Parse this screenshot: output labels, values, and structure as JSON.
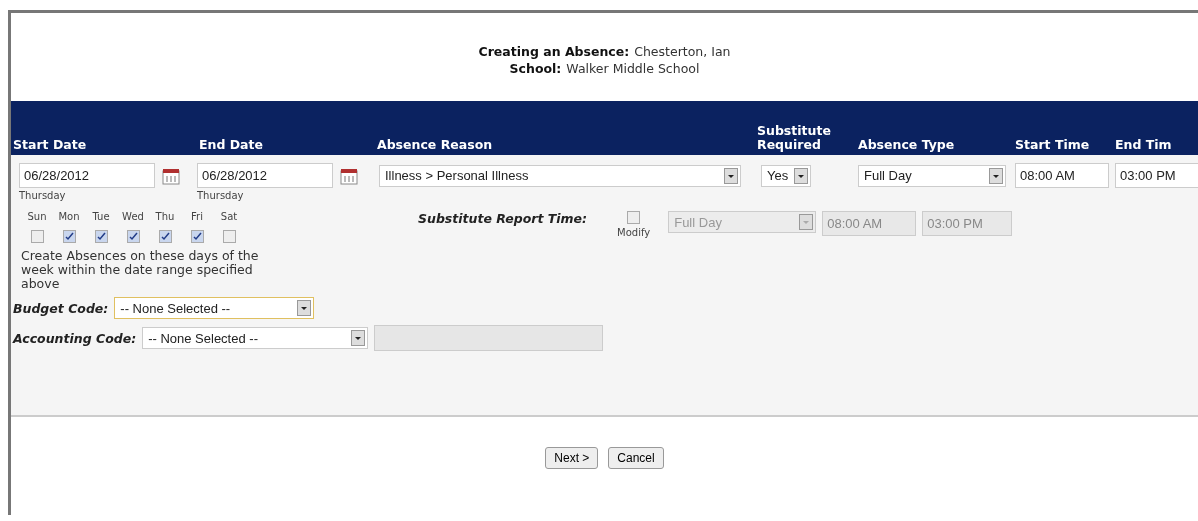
{
  "header": {
    "title_label": "Creating an Absence:",
    "title_value": "Chesterton, Ian",
    "school_label": "School:",
    "school_value": "Walker Middle School"
  },
  "columns": [
    {
      "label": "Start Date"
    },
    {
      "label": "End Date"
    },
    {
      "label": "Absence Reason"
    },
    {
      "label": "Substitute Required"
    },
    {
      "label": "Absence Type"
    },
    {
      "label": "Start Time"
    },
    {
      "label": "End Tim"
    }
  ],
  "start_date": {
    "value": "06/28/2012",
    "weekday": "Thursday"
  },
  "end_date": {
    "value": "06/28/2012",
    "weekday": "Thursday"
  },
  "absence_reason": {
    "value": "Illness > Personal Illness"
  },
  "substitute_required": {
    "value": "Yes"
  },
  "absence_type": {
    "value": "Full Day"
  },
  "start_time": {
    "value": "08:00 AM"
  },
  "end_time": {
    "value": "03:00 PM"
  },
  "days": [
    {
      "label": "Sun",
      "checked": false
    },
    {
      "label": "Mon",
      "checked": true
    },
    {
      "label": "Tue",
      "checked": true
    },
    {
      "label": "Wed",
      "checked": true
    },
    {
      "label": "Thu",
      "checked": true
    },
    {
      "label": "Fri",
      "checked": true
    },
    {
      "label": "Sat",
      "checked": false
    }
  ],
  "days_note": "Create Absences on these days of the week within the date range specified above",
  "substitute_report_time": {
    "label": "Substitute Report Time:",
    "modify_label": "Modify",
    "modify_checked": false,
    "type": "Full Day",
    "start": "08:00 AM",
    "end": "03:00 PM",
    "disabled": true
  },
  "budget_code": {
    "label": "Budget Code:",
    "value": "-- None Selected --",
    "focused": true
  },
  "accounting_code": {
    "label": "Accounting Code:",
    "value": "-- None Selected --"
  },
  "buttons": [
    {
      "label": "Next >"
    },
    {
      "label": "Cancel"
    }
  ]
}
